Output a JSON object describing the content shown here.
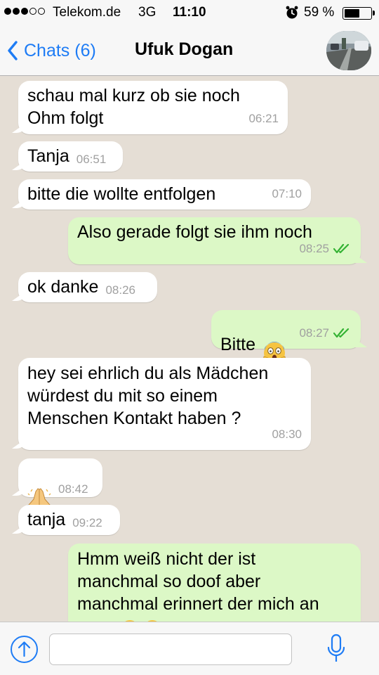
{
  "status_bar": {
    "carrier": "Telekom.de",
    "network": "3G",
    "time": "11:10",
    "battery_percent": "59 %",
    "battery_level": 0.59,
    "signal_bars_filled": 3,
    "signal_bars_total": 5
  },
  "nav": {
    "back_label": "Chats (6)",
    "contact_name": "Ufuk Dogan"
  },
  "messages": [
    {
      "direction": "in",
      "text": "schau mal kurz ob sie noch\nOhm folgt",
      "time": "06:21"
    },
    {
      "direction": "in",
      "text": "Tanja",
      "time": "06:51"
    },
    {
      "direction": "in",
      "text": "bitte die wollte entfolgen",
      "time": "07:10"
    },
    {
      "direction": "out",
      "text": "Also gerade folgt sie ihm noch",
      "time": "08:25",
      "read": true
    },
    {
      "direction": "in",
      "text": "ok danke",
      "time": "08:26"
    },
    {
      "direction": "out",
      "text": "Bitte",
      "emoji": "face-screaming-in-fear",
      "time": "08:27",
      "read": true
    },
    {
      "direction": "in",
      "text": "hey sei ehrlich du als Mädchen\nwürdest du mit so einem\nMenschen Kontakt haben ?",
      "time": "08:30"
    },
    {
      "direction": "in",
      "text": "",
      "emoji": "folded-hands",
      "time": "08:42"
    },
    {
      "direction": "in",
      "text": "tanja",
      "time": "09:22"
    },
    {
      "direction": "out",
      "text": "Hmm weiß nicht der ist\nmanchmal so doof aber\nmanchmal erinnert der mich an",
      "time": "",
      "read": false
    }
  ],
  "colors": {
    "accent": "#1e7cf5",
    "incoming_bubble": "#ffffff",
    "outgoing_bubble": "#dcf8c6",
    "chat_background": "#e5ded5",
    "read_ticks": "#34b233"
  },
  "icons": {
    "back": "chevron-left-icon",
    "upload": "arrow-up-circle-icon",
    "mic": "microphone-icon",
    "alarm": "alarm-clock-icon"
  },
  "input": {
    "placeholder": ""
  }
}
